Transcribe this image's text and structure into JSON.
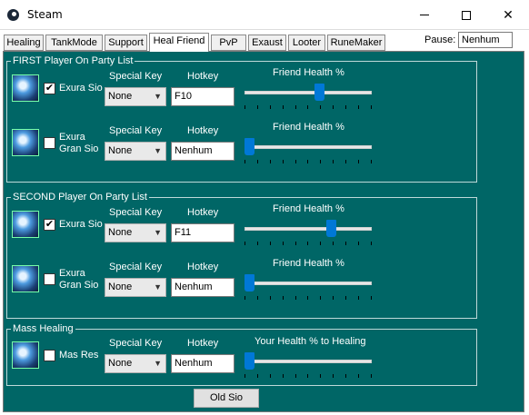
{
  "window": {
    "title": "Steam",
    "minimize": "—",
    "maximize": "☐",
    "close": "✕"
  },
  "tabs": [
    {
      "label": "Healing"
    },
    {
      "label": "TankMode"
    },
    {
      "label": "Support"
    },
    {
      "label": "Heal Friend",
      "active": true
    },
    {
      "label": "PvP"
    },
    {
      "label": "Exaust"
    },
    {
      "label": "Looter"
    },
    {
      "label": "RuneMaker"
    }
  ],
  "pause": {
    "label": "Pause:",
    "value": "Nenhum"
  },
  "groups": {
    "first": {
      "title": "FIRST Player On Party List",
      "rows": [
        {
          "spell": "Exura Sio",
          "checked": true,
          "special_key_label": "Special Key",
          "special_key": "None",
          "hotkey_label": "Hotkey",
          "hotkey": "F10",
          "slider_label": "Friend Health %",
          "slider_value": 60
        },
        {
          "spell": "Exura\nGran Sio",
          "checked": false,
          "special_key_label": "Special Key",
          "special_key": "None",
          "hotkey_label": "Hotkey",
          "hotkey": "Nenhum",
          "slider_label": "Friend Health %",
          "slider_value": 0
        }
      ]
    },
    "second": {
      "title": "SECOND Player On Party List",
      "rows": [
        {
          "spell": "Exura Sio",
          "checked": true,
          "special_key_label": "Special Key",
          "special_key": "None",
          "hotkey_label": "Hotkey",
          "hotkey": "F11",
          "slider_label": "Friend Health %",
          "slider_value": 70
        },
        {
          "spell": "Exura\nGran Sio",
          "checked": false,
          "special_key_label": "Special Key",
          "special_key": "None",
          "hotkey_label": "Hotkey",
          "hotkey": "Nenhum",
          "slider_label": "Friend Health %",
          "slider_value": 0
        }
      ]
    },
    "mass": {
      "title": "Mass Healing",
      "rows": [
        {
          "spell": "Mas Res",
          "checked": false,
          "special_key_label": "Special Key",
          "special_key": "None",
          "hotkey_label": "Hotkey",
          "hotkey": "Nenhum",
          "slider_label": "Your Health % to Healing",
          "slider_value": 0
        }
      ]
    }
  },
  "footer_button": "Old Sio",
  "colors": {
    "panel_bg": "#006666",
    "slider_thumb": "#0078d7"
  },
  "icons": {
    "app": "steam-icon",
    "spell": "spell-sparkle-icon",
    "select_arrow": "chevron-down-icon"
  }
}
